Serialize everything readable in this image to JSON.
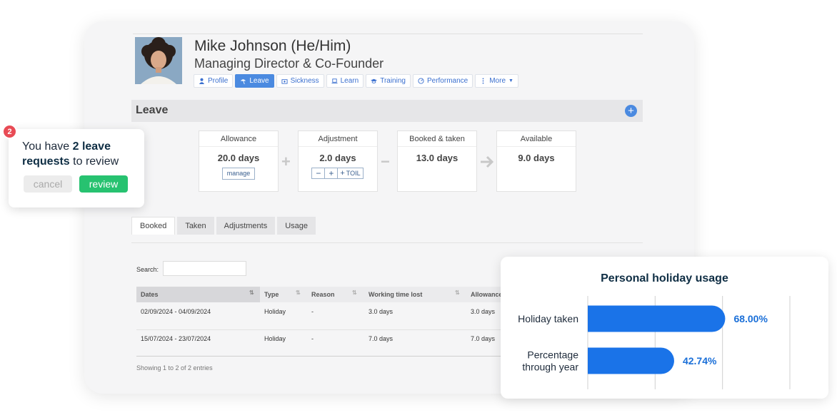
{
  "profile": {
    "name": "Mike Johnson (He/Him)",
    "role": "Managing Director & Co-Founder"
  },
  "nav_tabs": [
    {
      "label": "Profile",
      "icon": "person-icon",
      "active": false
    },
    {
      "label": "Leave",
      "icon": "beach-umbrella-icon",
      "active": true
    },
    {
      "label": "Sickness",
      "icon": "medical-kit-icon",
      "active": false
    },
    {
      "label": "Learn",
      "icon": "laptop-icon",
      "active": false
    },
    {
      "label": "Training",
      "icon": "graduation-cap-icon",
      "active": false
    },
    {
      "label": "Performance",
      "icon": "gauge-icon",
      "active": false
    },
    {
      "label": "More",
      "icon": "kebab-icon",
      "active": false
    }
  ],
  "leave": {
    "title": "Leave",
    "allowance": {
      "label": "Allowance",
      "value": "20.0 days",
      "manage_label": "manage"
    },
    "adjustment": {
      "label": "Adjustment",
      "value": "2.0 days",
      "minus_label": "−",
      "plus_label": "+",
      "toil_label": "TOIL"
    },
    "booked": {
      "label": "Booked & taken",
      "value": "13.0 days"
    },
    "available": {
      "label": "Available",
      "value": "9.0 days"
    },
    "operators": {
      "plus": "+",
      "minus": "−"
    }
  },
  "sub_tabs": [
    "Booked",
    "Taken",
    "Adjustments",
    "Usage"
  ],
  "table": {
    "search_label": "Search:",
    "columns": [
      "Dates",
      "Type",
      "Reason",
      "Working time lost",
      "Allowance"
    ],
    "rows": [
      {
        "dates": "02/09/2024 - 04/09/2024",
        "type": "Holiday",
        "reason": "-",
        "lost": "3.0 days",
        "allowance": "3.0 days"
      },
      {
        "dates": "15/07/2024 - 23/07/2024",
        "type": "Holiday",
        "reason": "-",
        "lost": "7.0 days",
        "allowance": "7.0 days"
      }
    ],
    "footer": "Showing 1 to 2 of 2 entries"
  },
  "notification": {
    "count": "2",
    "text_prefix": "You have ",
    "text_bold": "2 leave requests",
    "text_suffix": " to review",
    "cancel_label": "cancel",
    "review_label": "review"
  },
  "colors": {
    "accent": "#4b8ae0",
    "bar": "#1a73e8",
    "value_text": "#1a6fd8",
    "review_green": "#27c270",
    "badge_red": "#e84b55"
  },
  "chart_data": {
    "type": "bar",
    "orientation": "horizontal",
    "title": "Personal holiday usage",
    "categories": [
      "Holiday taken",
      "Percentage through year"
    ],
    "values": [
      68.0,
      42.74
    ],
    "value_labels": [
      "68.00%",
      "42.74%"
    ],
    "xlim": [
      0,
      100
    ],
    "grid": true
  }
}
